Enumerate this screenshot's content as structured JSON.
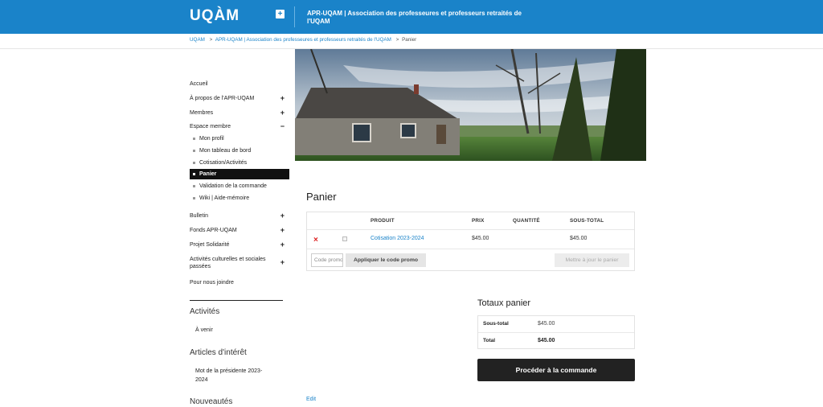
{
  "header": {
    "logo": "UQÀM",
    "expand_icon": "plus-icon",
    "site_title": "APR-UQAM | Association des professeures et professeurs retraités de l'UQAM",
    "colors": {
      "brand": "#1a83c9"
    }
  },
  "breadcrumb": {
    "items": [
      "UQAM",
      "APR-UQAM | Association des professeures et professeurs retraités de l'UQAM",
      "Panier"
    ],
    "separator": ">"
  },
  "sidebar": {
    "nav": [
      {
        "label": "Accueil",
        "toggle": ""
      },
      {
        "label": "À propos de l'APR-UQAM",
        "toggle": "+"
      },
      {
        "label": "Membres",
        "toggle": "+"
      },
      {
        "label": "Espace membre",
        "toggle": "−"
      }
    ],
    "sub": [
      {
        "label": "Mon profil"
      },
      {
        "label": "Mon tableau de bord"
      },
      {
        "label": "Cotisation/Activités"
      },
      {
        "label": "Panier"
      },
      {
        "label": "Validation de la commande"
      },
      {
        "label": "Wiki | Aide-mémoire"
      }
    ],
    "nav2": [
      {
        "label": "Bulletin",
        "toggle": "+"
      },
      {
        "label": "Fonds APR-UQAM",
        "toggle": "+"
      },
      {
        "label": "Projet Solidarité",
        "toggle": "+"
      },
      {
        "label": "Activités culturelles et sociales passées",
        "toggle": "+"
      },
      {
        "label": "Pour nous joindre",
        "toggle": ""
      }
    ],
    "widgets": [
      {
        "title": "Activités",
        "link": "À venir"
      },
      {
        "title": "Articles d'intérêt",
        "link": "Mot de la présidente 2023-2024"
      },
      {
        "title": "Nouveautés"
      }
    ]
  },
  "main": {
    "title": "Panier",
    "table": {
      "headers": [
        "PRODUIT",
        "PRIX",
        "QUANTITÉ",
        "SOUS-TOTAL"
      ],
      "rows": [
        {
          "remove": "×",
          "product": "Cotisation 2023-2024",
          "price": "$45.00",
          "quantity": "",
          "subtotal": "$45.00"
        }
      ],
      "coupon_placeholder": "Code promo",
      "apply_coupon": "Appliquer le code promo",
      "update_cart": "Mettre à jour le panier"
    },
    "totals": {
      "title": "Totaux panier",
      "rows": [
        {
          "label": "Sous-total",
          "value": "$45.00"
        },
        {
          "label": "Total",
          "value": "$45.00"
        }
      ],
      "checkout": "Procéder à la commande"
    },
    "edit_link": "Edit"
  }
}
